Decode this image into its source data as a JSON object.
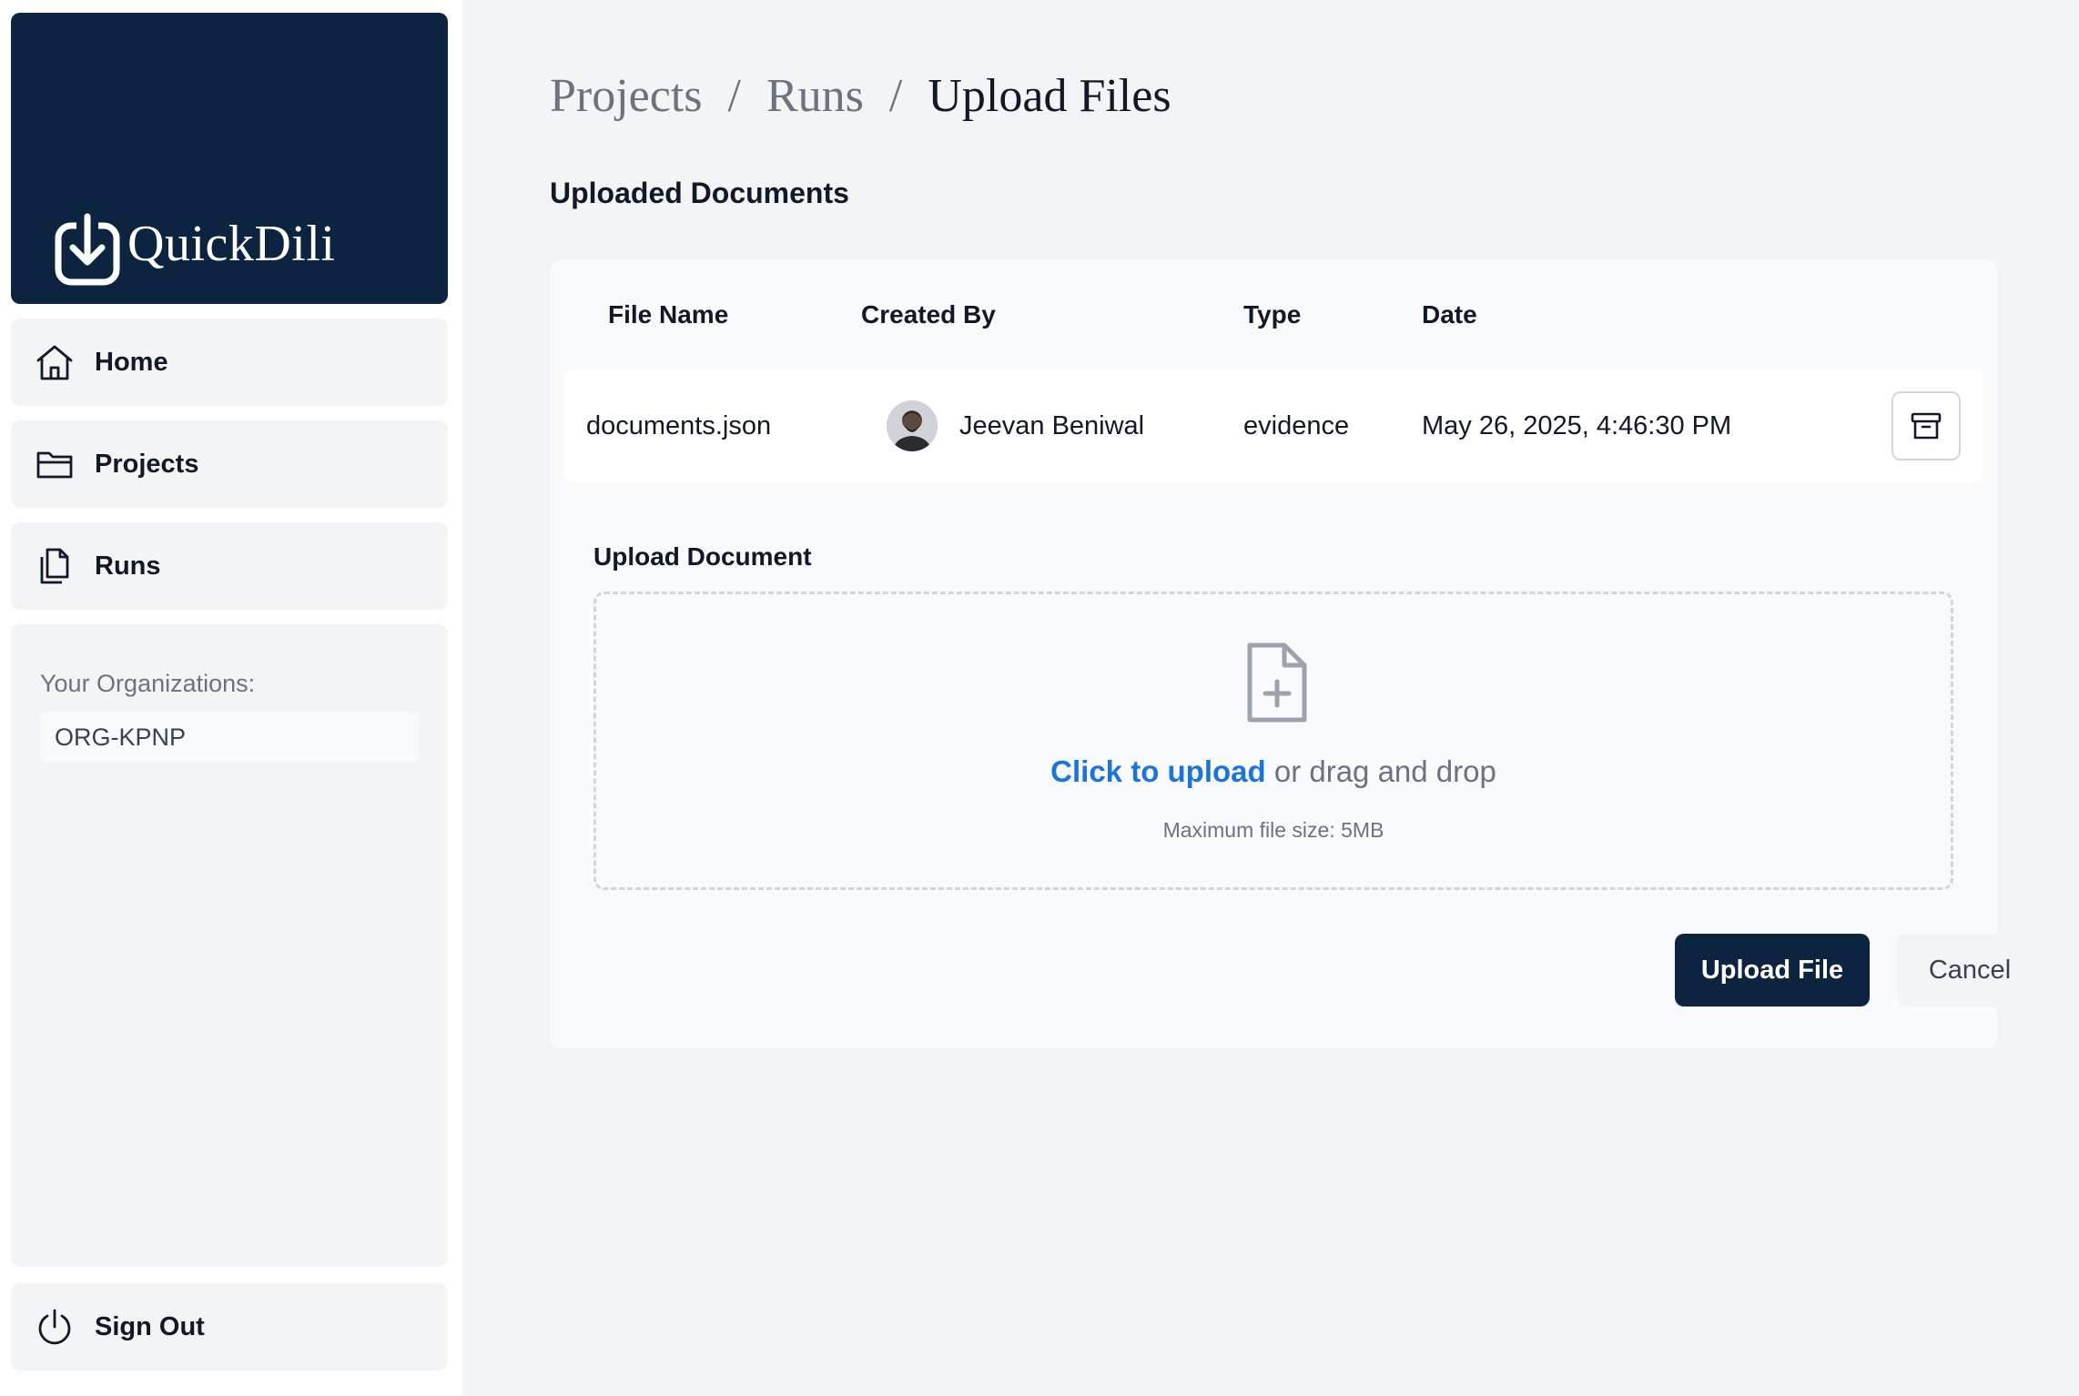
{
  "app": {
    "brand": "QuickDili"
  },
  "sidebar": {
    "items": [
      {
        "label": "Home",
        "icon": "home-icon"
      },
      {
        "label": "Projects",
        "icon": "folder-icon"
      },
      {
        "label": "Runs",
        "icon": "files-icon"
      }
    ],
    "org_label": "Your Organizations:",
    "org_value": "ORG-KPNP",
    "sign_out": "Sign Out"
  },
  "breadcrumb": {
    "items": [
      "Projects",
      "Runs",
      "Upload Files"
    ],
    "separator": "/"
  },
  "documents": {
    "title": "Uploaded Documents",
    "columns": [
      "File Name",
      "Created By",
      "Type",
      "Date"
    ],
    "rows": [
      {
        "file_name": "documents.json",
        "created_by": "Jeevan Beniwal",
        "type": "evidence",
        "date": "May 26, 2025, 4:46:30 PM"
      }
    ]
  },
  "upload": {
    "label": "Upload Document",
    "click_text": "Click to upload",
    "drag_text": " or drag and drop",
    "max_size": "Maximum file size: 5MB",
    "submit": "Upload File",
    "cancel": "Cancel"
  },
  "colors": {
    "brand_dark": "#0c2440",
    "link_blue": "#1d74d8",
    "background": "#f3f4f6"
  }
}
